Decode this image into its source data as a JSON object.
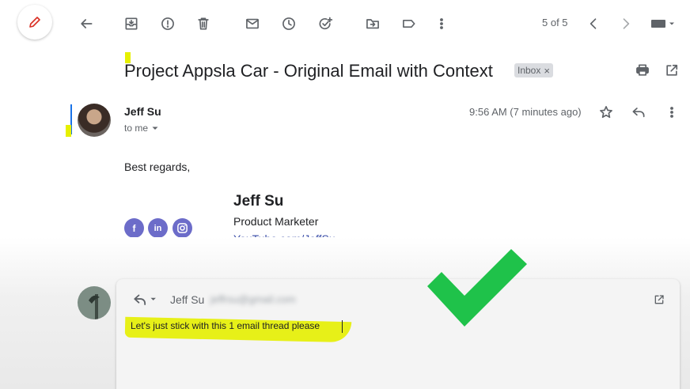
{
  "toolbar": {
    "pager": "5 of 5"
  },
  "email": {
    "subject": "Project Appsla Car - Original Email with Context",
    "label_chip": "Inbox",
    "label_chip_remove": "×",
    "sender_name": "Jeff Su",
    "recipient": "to me",
    "time": "9:56 AM (7 minutes ago)",
    "body": "Best regards,",
    "signature": {
      "name": "Jeff Su",
      "title": "Product Marketer",
      "link": "YouTube.com/JeffSu",
      "social": [
        "f",
        "in",
        "ig"
      ]
    }
  },
  "reply": {
    "from": "Jeff Su",
    "from_email": "jeffrsu@gmail.com",
    "text": "Let's just stick with this 1 email thread please"
  },
  "colors": {
    "highlight": "#e6f000",
    "checkmark": "#1fc24a",
    "social": "#6c6cc9"
  }
}
